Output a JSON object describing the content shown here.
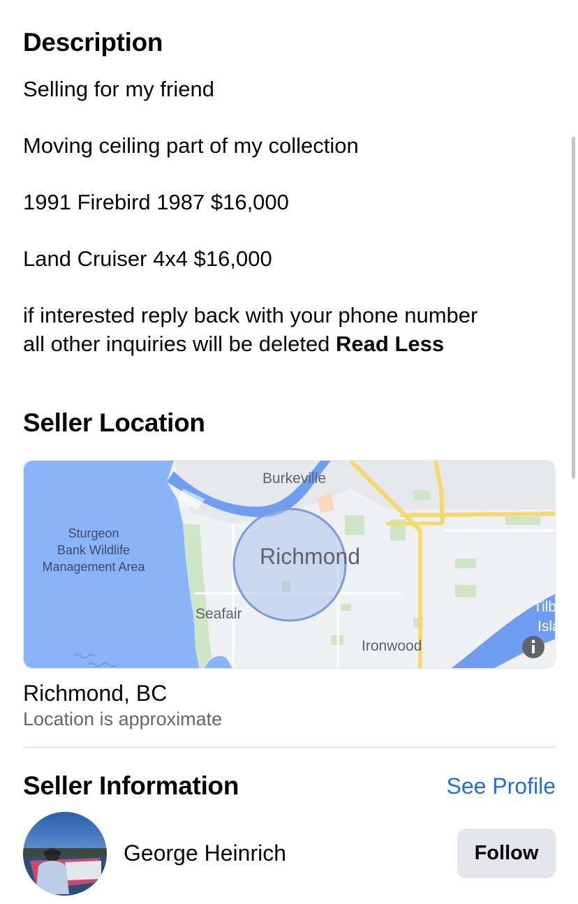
{
  "description": {
    "title": "Description",
    "lines": [
      "Selling for my friend",
      "Moving ceiling part of my collection",
      "1991 Firebird 1987 $16,000",
      "Land Cruiser 4x4  $16,000",
      "if interested reply back with your phone number",
      "all other inquiries will be deleted"
    ],
    "read_less": "Read Less"
  },
  "seller_location": {
    "title": "Seller Location",
    "map": {
      "labels": {
        "burkeville": "Burkeville",
        "sturgeon_1": "Sturgeon",
        "sturgeon_2": "Bank Wildlife",
        "sturgeon_3": "Management Area",
        "richmond": "Richmond",
        "seafair": "Seafair",
        "ironwood": "Ironwood",
        "tilb_1": "Tilb",
        "tilb_2": "Isla"
      },
      "info_icon": "info-icon"
    },
    "city": "Richmond, BC",
    "note": "Location is approximate"
  },
  "seller_information": {
    "title": "Seller Information",
    "see_profile": "See Profile",
    "name": "George Heinrich",
    "follow_label": "Follow"
  },
  "colors": {
    "link": "#216fdb",
    "water": "#8ab4f8",
    "land": "#eef0f3",
    "road": "#f6d96b",
    "button_bg": "#e4e6eb",
    "secondary_text": "#65676b"
  }
}
